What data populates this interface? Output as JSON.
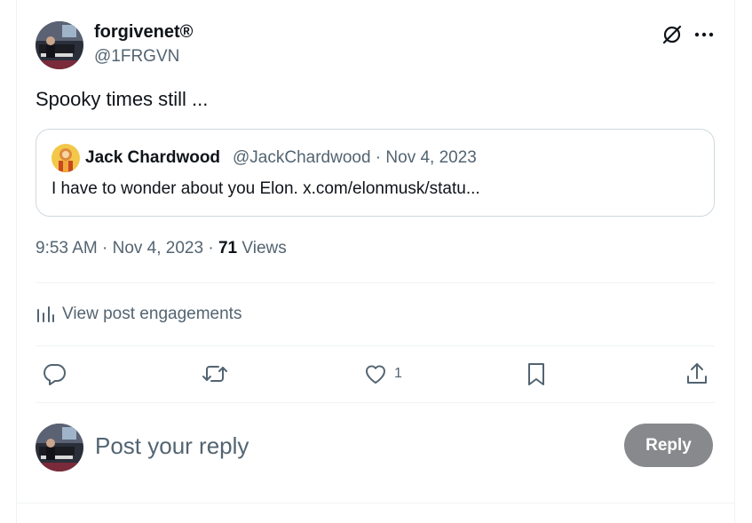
{
  "post": {
    "author": {
      "display_name": "forgivenet®",
      "handle": "@1FRGVN",
      "avatar_icon": "piano-player-avatar"
    },
    "text": "Spooky times still ...",
    "quoted": {
      "display_name": "Jack Chardwood",
      "meta": "@JackChardwood · Nov 4, 2023",
      "text": "I have to wonder about you Elon. x.com/elonmusk/statu...",
      "avatar_icon": "golden-figure-avatar"
    },
    "time": "9:53 AM",
    "date": "Nov 4, 2023",
    "separator": "·",
    "views_count": "71",
    "views_label": "Views",
    "engagements_label": "View post engagements"
  },
  "actions": {
    "reply_icon": "comment-icon",
    "repost_icon": "repost-icon",
    "like_icon": "heart-icon",
    "like_count": "1",
    "bookmark_icon": "bookmark-icon",
    "share_icon": "share-icon"
  },
  "composer": {
    "placeholder": "Post your reply",
    "button_label": "Reply"
  },
  "colors": {
    "text_primary": "#0f1419",
    "text_secondary": "#536471",
    "border": "#cfd9de",
    "divider": "#eff3f4",
    "reply_button_disabled": "#87898c"
  }
}
